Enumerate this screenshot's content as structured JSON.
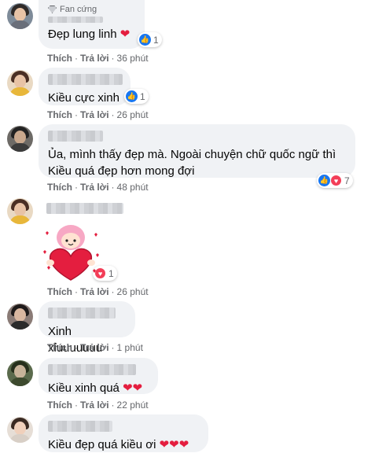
{
  "reactions_label_like": "👍",
  "reactions_label_heart": "♥",
  "comments": [
    {
      "badge": "Fan cứng",
      "text": "Đẹp lung linh",
      "emoji": "❤",
      "reaction_count": "1",
      "like": "Thích",
      "reply": "Trả lời",
      "time": "36 phút"
    },
    {
      "text": "Kiều cực xinh",
      "reaction_count": "1",
      "like": "Thích",
      "reply": "Trả lời",
      "time": "26 phút"
    },
    {
      "text": "Ủa, mình thấy đẹp mà. Ngoài chuyện chữ quốc ngữ thì\nKiều quá đẹp hơn mong đợi",
      "reaction_count": "7",
      "like": "Thích",
      "reply": "Trả lời",
      "time": "48 phút"
    },
    {
      "reaction_count": "1",
      "like": "Thích",
      "reply": "Trả lời",
      "time": "26 phút"
    },
    {
      "text": "Xinh xỉuuuuuuu",
      "like": "Thích",
      "reply": "Trả lời",
      "time": "1 phút"
    },
    {
      "text": "Kiều xinh quá",
      "emoji": "❤❤",
      "like": "Thích",
      "reply": "Trả lời",
      "time": "22 phút"
    },
    {
      "text": "Kiều đẹp quá kiều ơi",
      "emoji": "❤❤❤"
    }
  ]
}
